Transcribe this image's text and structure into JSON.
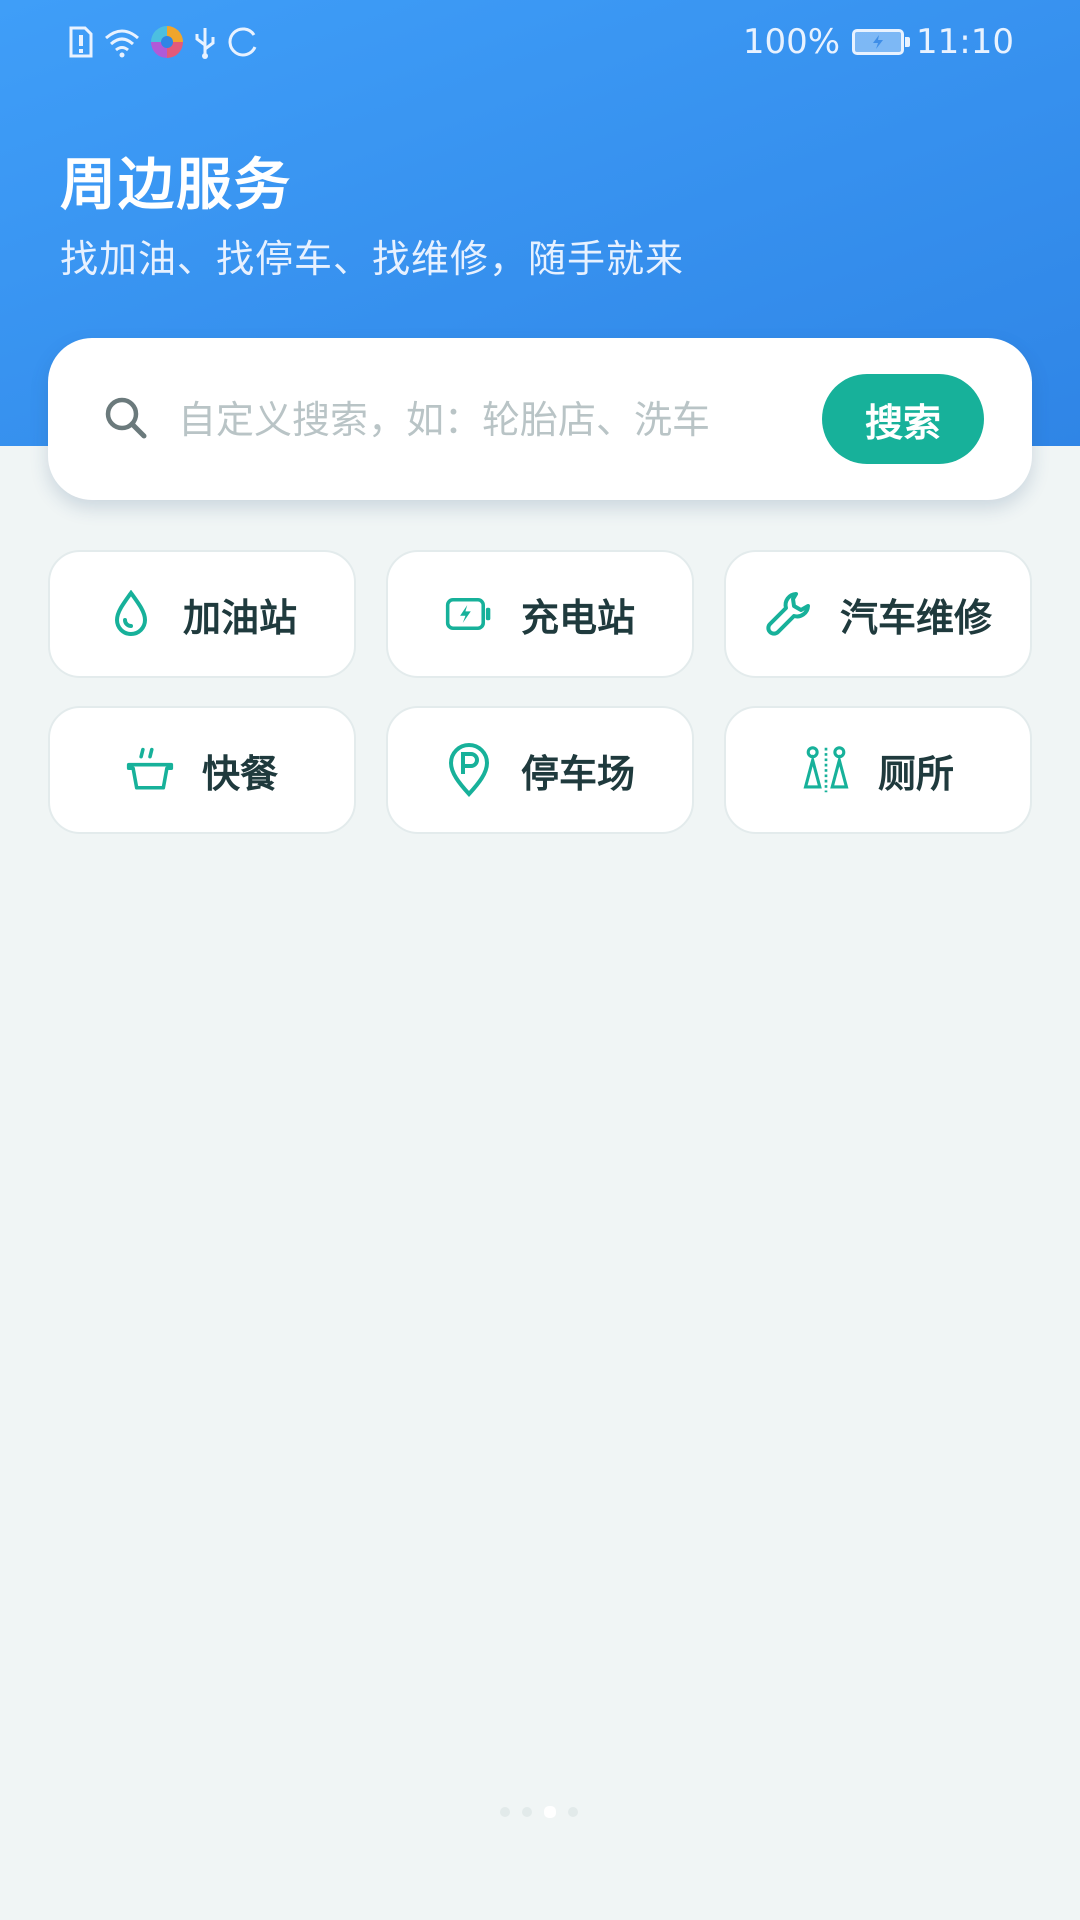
{
  "status_bar": {
    "battery_percent": "100%",
    "time": "11:10",
    "icons": [
      "sim-alert-icon",
      "wifi-icon",
      "app-notification-icon",
      "usb-icon",
      "sync-icon"
    ]
  },
  "header": {
    "title": "周边服务",
    "subtitle": "找加油、找停车、找维修，随手就来"
  },
  "search": {
    "placeholder": "自定义搜索，如：轮胎店、洗车",
    "value": "",
    "button_label": "搜索"
  },
  "services": [
    {
      "label": "加油站",
      "icon": "fuel-drop-icon"
    },
    {
      "label": "充电站",
      "icon": "charging-battery-icon"
    },
    {
      "label": "汽车维修",
      "icon": "wrench-icon"
    },
    {
      "label": "快餐",
      "icon": "fast-food-bowl-icon"
    },
    {
      "label": "停车场",
      "icon": "parking-pin-icon"
    },
    {
      "label": "厕所",
      "icon": "restroom-icon"
    }
  ],
  "pager": {
    "total": 4,
    "active_index": 2
  },
  "colors": {
    "header_gradient_start": "#3f9ef8",
    "header_gradient_end": "#2f85e6",
    "accent": "#17b19a",
    "icon": "#17b19a",
    "tile_label": "#1f3a3d",
    "page_background": "#f0f5f5"
  }
}
